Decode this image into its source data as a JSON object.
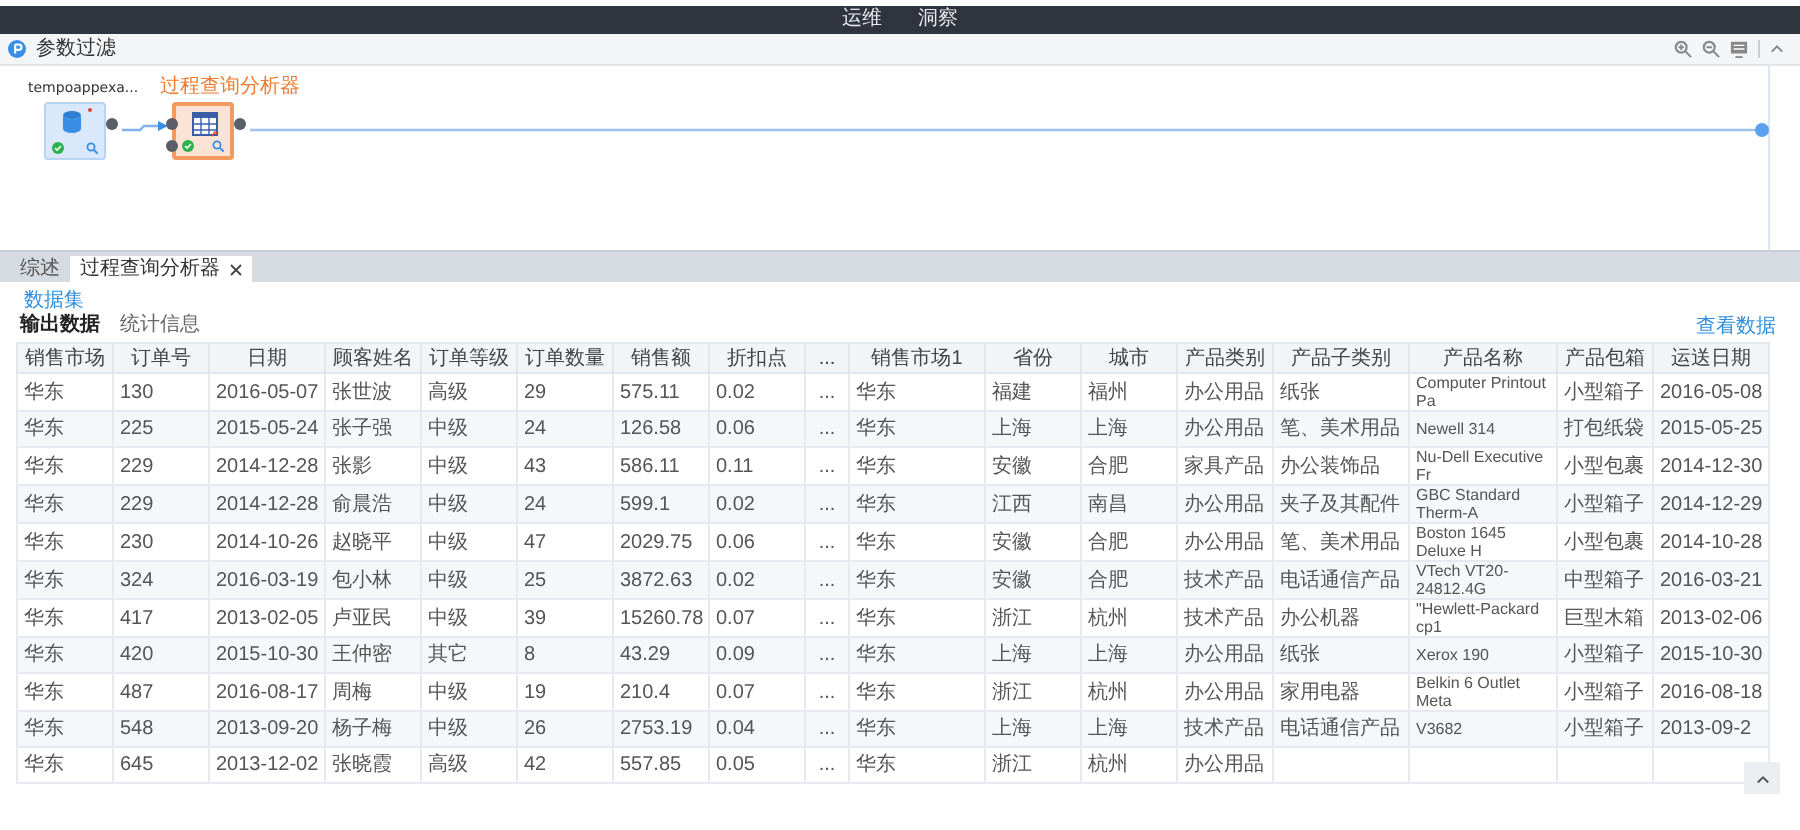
{
  "top_nav": [
    "运维",
    "洞察"
  ],
  "toolbar": {
    "title": "参数过滤"
  },
  "flow": {
    "nodes": [
      {
        "label": "tempoappexa...",
        "kind": "dataset",
        "selected": false,
        "flag": true
      },
      {
        "label": "过程查询分析器",
        "kind": "table",
        "selected": true,
        "flag": false
      }
    ]
  },
  "tabs": [
    {
      "label": "综述",
      "selected": false,
      "closable": false
    },
    {
      "label": "过程查询分析器",
      "selected": true,
      "closable": true
    }
  ],
  "dataset_link": "数据集",
  "subtabs": [
    {
      "label": "输出数据",
      "selected": true
    },
    {
      "label": "统计信息",
      "selected": false
    }
  ],
  "view_link": "查看数据",
  "table": {
    "columns": [
      {
        "label": "销售市场",
        "kind": "text"
      },
      {
        "label": "订单号",
        "kind": "text"
      },
      {
        "label": "日期",
        "kind": "date"
      },
      {
        "label": "顾客姓名",
        "kind": "text"
      },
      {
        "label": "订单等级",
        "kind": "text"
      },
      {
        "label": "订单数量",
        "kind": "text"
      },
      {
        "label": "销售额",
        "kind": "text"
      },
      {
        "label": "折扣点",
        "kind": "text"
      },
      {
        "label": "...",
        "kind": "more"
      },
      {
        "label": "销售市场1",
        "kind": "text"
      },
      {
        "label": "省份",
        "kind": "text"
      },
      {
        "label": "城市",
        "kind": "text"
      },
      {
        "label": "产品类别",
        "kind": "text"
      },
      {
        "label": "产品子类别",
        "kind": "text"
      },
      {
        "label": "产品名称",
        "kind": "long"
      },
      {
        "label": "产品包箱",
        "kind": "text"
      },
      {
        "label": "运送日期",
        "kind": "date"
      }
    ],
    "rows": [
      [
        "华东",
        "130",
        "2016-05-07",
        "张世波",
        "高级",
        "29",
        "575.11",
        "0.02",
        "...",
        "华东",
        "福建",
        "福州",
        "办公用品",
        "纸张",
        "Computer Printout Pa",
        "小型箱子",
        "2016-05-08"
      ],
      [
        "华东",
        "225",
        "2015-05-24",
        "张子强",
        "中级",
        "24",
        "126.58",
        "0.06",
        "...",
        "华东",
        "上海",
        "上海",
        "办公用品",
        "笔、美术用品",
        "Newell 314",
        "打包纸袋",
        "2015-05-25"
      ],
      [
        "华东",
        "229",
        "2014-12-28",
        "张影",
        "中级",
        "43",
        "586.11",
        "0.11",
        "...",
        "华东",
        "安徽",
        "合肥",
        "家具产品",
        "办公装饰品",
        "Nu-Dell Executive Fr",
        "小型包裹",
        "2014-12-30"
      ],
      [
        "华东",
        "229",
        "2014-12-28",
        "俞晨浩",
        "中级",
        "24",
        "599.1",
        "0.02",
        "...",
        "华东",
        "江西",
        "南昌",
        "办公用品",
        "夹子及其配件",
        "GBC Standard Therm-A",
        "小型箱子",
        "2014-12-29"
      ],
      [
        "华东",
        "230",
        "2014-10-26",
        "赵晓平",
        "中级",
        "47",
        "2029.75",
        "0.06",
        "...",
        "华东",
        "安徽",
        "合肥",
        "办公用品",
        "笔、美术用品",
        "Boston 1645 Deluxe H",
        "小型包裹",
        "2014-10-28"
      ],
      [
        "华东",
        "324",
        "2016-03-19",
        "包小林",
        "中级",
        "25",
        "3872.63",
        "0.02",
        "...",
        "华东",
        "安徽",
        "合肥",
        "技术产品",
        "电话通信产品",
        "VTech VT20-24812.4G",
        "中型箱子",
        "2016-03-21"
      ],
      [
        "华东",
        "417",
        "2013-02-05",
        "卢亚民",
        "中级",
        "39",
        "15260.78",
        "0.07",
        "...",
        "华东",
        "浙江",
        "杭州",
        "技术产品",
        "办公机器",
        "\"Hewlett-Packard cp1",
        "巨型木箱",
        "2013-02-06"
      ],
      [
        "华东",
        "420",
        "2015-10-30",
        "王仲密",
        "其它",
        "8",
        "43.29",
        "0.09",
        "...",
        "华东",
        "上海",
        "上海",
        "办公用品",
        "纸张",
        "Xerox 190",
        "小型箱子",
        "2015-10-30"
      ],
      [
        "华东",
        "487",
        "2016-08-17",
        "周梅",
        "中级",
        "19",
        "210.4",
        "0.07",
        "...",
        "华东",
        "浙江",
        "杭州",
        "办公用品",
        "家用电器",
        "Belkin 6 Outlet Meta",
        "小型箱子",
        "2016-08-18"
      ],
      [
        "华东",
        "548",
        "2013-09-20",
        "杨子梅",
        "中级",
        "26",
        "2753.19",
        "0.04",
        "...",
        "华东",
        "上海",
        "上海",
        "技术产品",
        "电话通信产品",
        "V3682",
        "小型箱子",
        "2013-09-2"
      ],
      [
        "华东",
        "645",
        "2013-12-02",
        "张晓霞",
        "高级",
        "42",
        "557.85",
        "0.05",
        "...",
        "华东",
        "浙江",
        "杭州",
        "办公用品"
      ]
    ]
  }
}
